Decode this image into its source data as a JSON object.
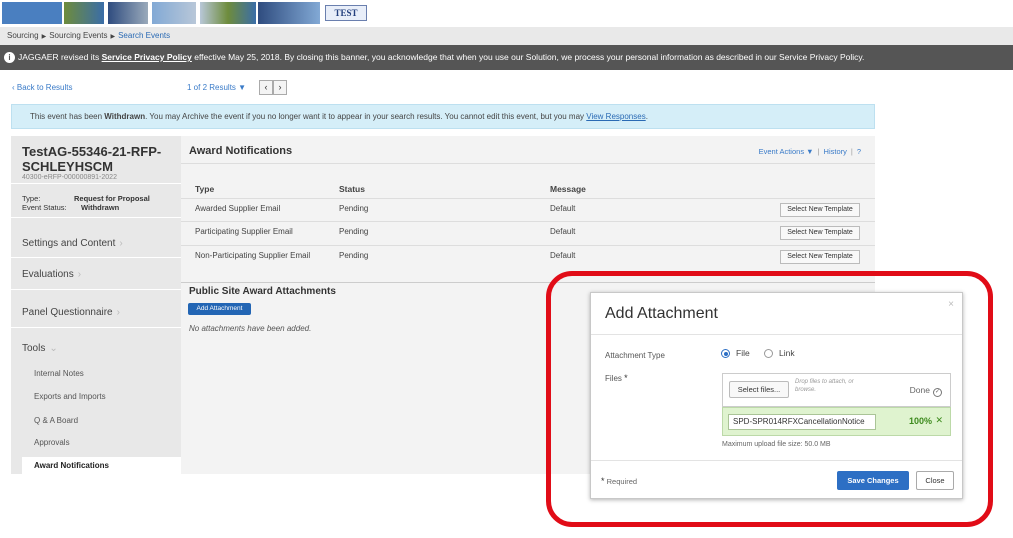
{
  "banner": {
    "test_label": "TEST",
    "colors": [
      "#3a6da8",
      "#82a9d5",
      "#6e8c3c",
      "#b8c7d8",
      "#2f4c7f",
      "#9aaabb"
    ]
  },
  "breadcrumb": {
    "items": [
      "Sourcing",
      "Sourcing Events",
      "Search Events"
    ]
  },
  "privacy_banner": {
    "text_pre": "JAGGAER revised its ",
    "link": "Service Privacy Policy",
    "text_post": " effective May 25, 2018. By closing this banner, you acknowledge that when you use our Solution, we process your personal information as described in our Service Privacy Policy."
  },
  "pager": {
    "back": "‹ Back to Results",
    "results": "1 of 2 Results ▼",
    "prev": "‹",
    "next": "›"
  },
  "notice": {
    "pre": "This event has been ",
    "status": "Withdrawn",
    "mid": ". You may Archive the event if you no longer want it to appear in your search results. You cannot edit this event, but you may ",
    "link": "View Responses",
    "post": "."
  },
  "sidebar": {
    "event_title": "TestAG-55346-21-RFP-SCHLEYHSCM",
    "event_id": "40300-eRFP-000000891-2022",
    "type_label": "Type:",
    "type_value": "Request for Proposal",
    "status_label": "Event Status:",
    "status_value": "Withdrawn",
    "nav": [
      "Settings and Content",
      "Evaluations",
      "Panel Questionnaire",
      "Tools"
    ],
    "tools": [
      "Internal Notes",
      "Exports and Imports",
      "Q & A Board",
      "Approvals",
      "Award Notifications"
    ]
  },
  "main": {
    "title": "Award Notifications",
    "event_actions": "Event Actions ▼",
    "history": "History",
    "help": "?",
    "columns": [
      "Type",
      "Status",
      "Message"
    ],
    "rows": [
      {
        "type": "Awarded Supplier Email",
        "status": "Pending",
        "message": "Default",
        "button": "Select New Template"
      },
      {
        "type": "Participating Supplier Email",
        "status": "Pending",
        "message": "Default",
        "button": "Select New Template"
      },
      {
        "type": "Non-Participating Supplier Email",
        "status": "Pending",
        "message": "Default",
        "button": "Select New Template"
      }
    ],
    "attachments_title": "Public Site Award Attachments",
    "add_attachment": "Add Attachment",
    "no_attachments": "No attachments have been added."
  },
  "modal": {
    "title": "Add Attachment",
    "close_x": "×",
    "type_label": "Attachment Type",
    "opt_file": "File",
    "opt_link": "Link",
    "files_label": "Files",
    "required_star": "*",
    "select_files": "Select files...",
    "drop_hint": "Drop files to attach, or browse.",
    "done": "Done",
    "file_name": "SPD-SPR014RFXCancellationNotice",
    "progress": "100%",
    "progress_value": 1.0,
    "max_size": "Maximum upload file size: 50.0 MB",
    "required_note": "Required",
    "save": "Save Changes",
    "close": "Close"
  }
}
